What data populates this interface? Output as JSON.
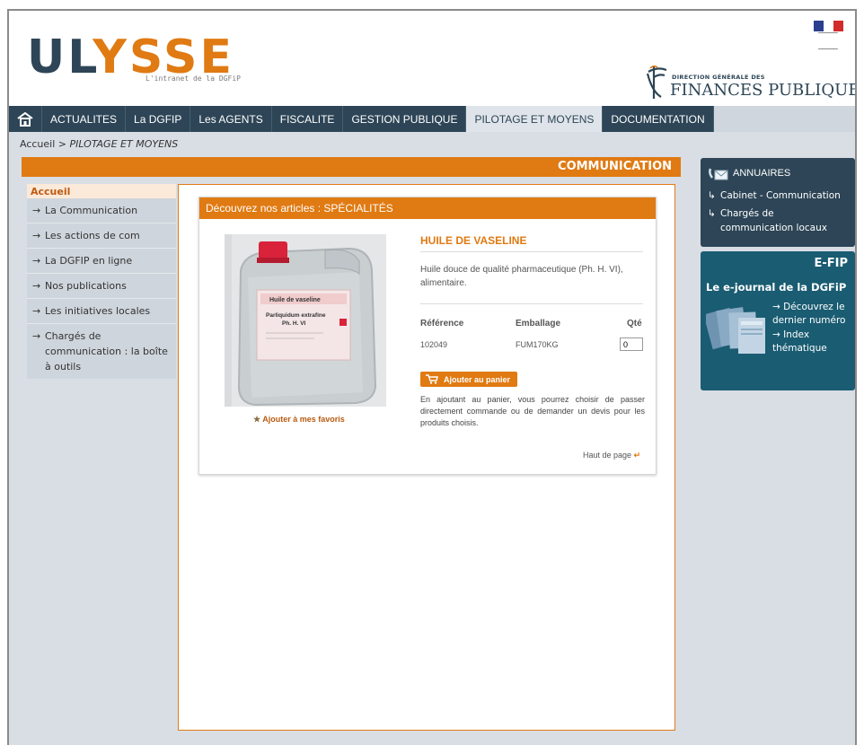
{
  "header": {
    "logo_part1": "UL",
    "logo_part2": "YSSE",
    "logo_sub": "L'intranet de la DGFiP",
    "dgfip_small": "DIRECTION GÉNÉRALE DES",
    "dgfip_big": "FINANCES PUBLIQUES"
  },
  "nav": {
    "items": [
      {
        "label": "ACTUALITES"
      },
      {
        "label": "La DGFIP"
      },
      {
        "label": "Les AGENTS"
      },
      {
        "label": "FISCALITE"
      },
      {
        "label": "GESTION PUBLIQUE"
      },
      {
        "label": "PILOTAGE ET MOYENS"
      },
      {
        "label": "DOCUMENTATION"
      }
    ]
  },
  "breadcrumb": {
    "home": "Accueil",
    "sep": " > ",
    "current": "PILOTAGE ET MOYENS"
  },
  "section": {
    "title": "COMMUNICATION"
  },
  "left_menu": {
    "home": "Accueil",
    "items": [
      {
        "label": "La Communication"
      },
      {
        "label": "Les actions de com"
      },
      {
        "label": "La DGFIP en ligne"
      },
      {
        "label": "Nos publications"
      },
      {
        "label": "Les initiatives locales"
      },
      {
        "label": "Chargés de communication : la boîte à outils"
      }
    ]
  },
  "product": {
    "header": "Découvrez nos articles : SPÉCIALITÉS",
    "title": "HUILE DE VASELINE",
    "description": "Huile douce de qualité pharmaceutique (Ph. H. VI), alimentaire.",
    "label_line1": "Huile de vaseline",
    "label_line2": "Parliquidum extrafine",
    "label_line3": "Ph. H. VI",
    "fav": "Ajouter à mes favoris",
    "col_ref": "Référence",
    "col_pack": "Emballage",
    "col_qty": "Qté",
    "ref": "102049",
    "pack": "FUM170KG",
    "qty": "0",
    "cart_btn": "Ajouter au panier",
    "cart_note": "En ajoutant au panier, vous pourrez choisir de passer directement commande ou de demander un devis pour les produits choisis.",
    "top_link": "Haut de page"
  },
  "annuaires": {
    "title": "ANNUAIRES",
    "links": [
      {
        "label": "Cabinet - Communication"
      },
      {
        "label": "Chargés de communication locaux"
      }
    ]
  },
  "efip": {
    "title": "E-FIP",
    "subtitle": "Le e-journal de la DGFiP",
    "links": [
      {
        "label": "Découvrez le dernier numéro"
      },
      {
        "label": "Index thématique"
      }
    ]
  },
  "colors": {
    "navy": "#2d4556",
    "orange": "#e07a12",
    "teal": "#1a5c72"
  }
}
